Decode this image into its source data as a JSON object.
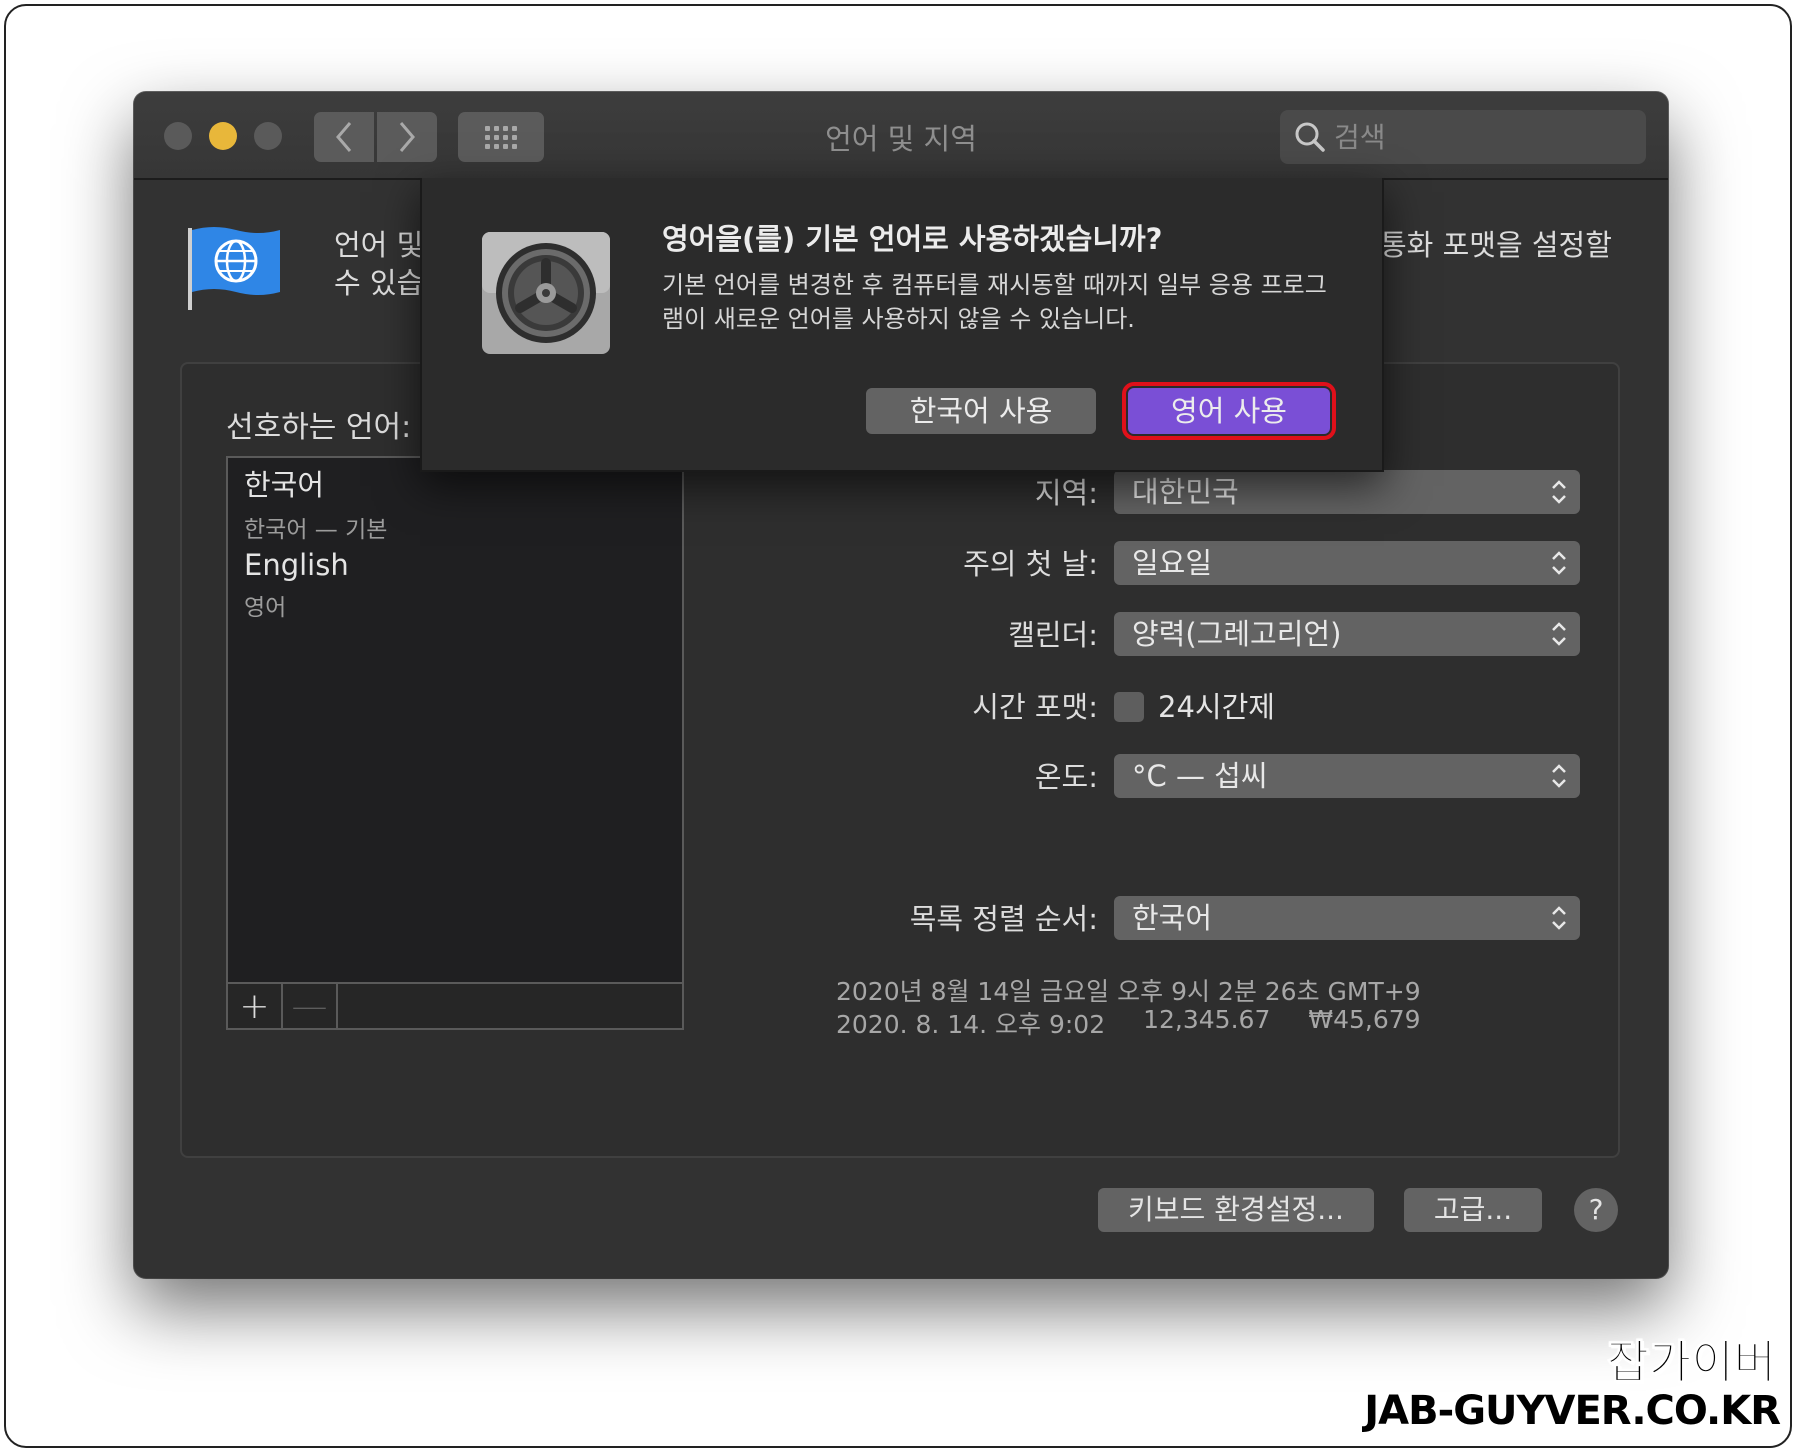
{
  "window": {
    "title": "언어 및 지역"
  },
  "search": {
    "placeholder": "검색"
  },
  "intro": {
    "line1": "언어 및",
    "line2": "수 있습",
    "right_text": "통화 포맷을 설정할"
  },
  "preferred_languages": {
    "label": "선호하는 언어:",
    "items": [
      {
        "name": "한국어",
        "sub": "한국어 — 기본"
      },
      {
        "name": "English",
        "sub": "영어"
      }
    ],
    "add_symbol": "+",
    "remove_symbol": "—"
  },
  "settings": {
    "region": {
      "label": "지역:",
      "value": "대한민국"
    },
    "first_day": {
      "label": "주의 첫 날:",
      "value": "일요일"
    },
    "calendar": {
      "label": "캘린더:",
      "value": "양력(그레고리언)"
    },
    "time_format": {
      "label": "시간 포맷:",
      "checkbox_label": "24시간제",
      "checked": false
    },
    "temperature": {
      "label": "온도:",
      "value": "°C — 섭씨"
    },
    "sort_order": {
      "label": "목록 정렬 순서:",
      "value": "한국어"
    }
  },
  "sample": {
    "line1": "2020년 8월 14일 금요일 오후 9시 2분 26초 GMT+9",
    "date_short": "2020. 8. 14. 오후 9:02",
    "number": "12,345.67",
    "currency": "₩45,679"
  },
  "buttons": {
    "keyboard": "키보드 환경설정...",
    "advanced": "고급...",
    "help": "?"
  },
  "dialog": {
    "title": "영어을(를) 기본 언어로 사용하겠습니까?",
    "body_line1": "기본 언어를 변경한 후 컴퓨터를 재시동할 때까지 일부 응용 프로그",
    "body_line2": "램이 새로운 언어를 사용하지 않을 수 있습니다.",
    "secondary_button": "한국어 사용",
    "primary_button": "영어 사용"
  },
  "watermark": {
    "korean": "잡가이버",
    "domain": "JAB-GUYVER.CO.KR"
  },
  "colors": {
    "window_bg": "#323232",
    "accent": "#7a4fd6",
    "highlight": "#e0101a",
    "minimize": "#e8b73a"
  }
}
